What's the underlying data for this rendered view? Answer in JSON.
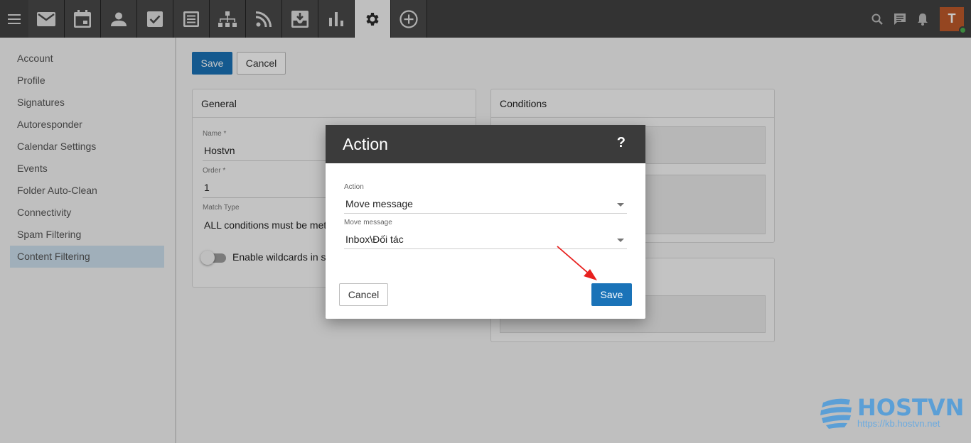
{
  "topbar": {
    "apps": [
      {
        "icon": "mail-icon",
        "name": "app-tab-mail"
      },
      {
        "icon": "calendar-icon",
        "name": "app-tab-calendar"
      },
      {
        "icon": "contacts-icon",
        "name": "app-tab-contacts"
      },
      {
        "icon": "tasks-icon",
        "name": "app-tab-tasks"
      },
      {
        "icon": "notes-icon",
        "name": "app-tab-notes"
      },
      {
        "icon": "org-chart-icon",
        "name": "app-tab-directory"
      },
      {
        "icon": "rss-icon",
        "name": "app-tab-feeds"
      },
      {
        "icon": "archive-icon",
        "name": "app-tab-archive"
      },
      {
        "icon": "reports-icon",
        "name": "app-tab-reports"
      },
      {
        "icon": "gear-icon",
        "name": "app-tab-settings",
        "active": true
      },
      {
        "icon": "add-circle-icon",
        "name": "app-tab-add"
      }
    ],
    "avatar_letter": "T",
    "colors": {
      "bar": "#424242",
      "avatar": "#bf5a2b",
      "status": "#4caf50"
    }
  },
  "sidebar": {
    "items": [
      {
        "label": "Account"
      },
      {
        "label": "Profile"
      },
      {
        "label": "Signatures"
      },
      {
        "label": "Autoresponder"
      },
      {
        "label": "Calendar Settings"
      },
      {
        "label": "Events"
      },
      {
        "label": "Folder Auto-Clean"
      },
      {
        "label": "Connectivity"
      },
      {
        "label": "Spam Filtering"
      },
      {
        "label": "Content Filtering",
        "active": true
      }
    ]
  },
  "main": {
    "save_label": "Save",
    "cancel_label": "Cancel",
    "general": {
      "title": "General",
      "name_label": "Name *",
      "name_value": "Hostvn",
      "order_label": "Order *",
      "order_value": "1",
      "match_label": "Match Type",
      "match_value": "ALL conditions must be met",
      "wildcard_label": "Enable wildcards in s"
    },
    "conditions": {
      "title": "Conditions"
    }
  },
  "dialog": {
    "title": "Action",
    "help": "?",
    "action_label": "Action",
    "action_value": "Move message",
    "move_label": "Move message",
    "move_value": "Inbox\\Đối tác",
    "cancel_label": "Cancel",
    "save_label": "Save",
    "colors": {
      "primary": "#1a73b8",
      "header": "#3b3b3b"
    }
  },
  "watermark": {
    "brand": "HOSTVN",
    "url": "https://kb.hostvn.net"
  },
  "annotation": {
    "color": "#e8201e"
  }
}
